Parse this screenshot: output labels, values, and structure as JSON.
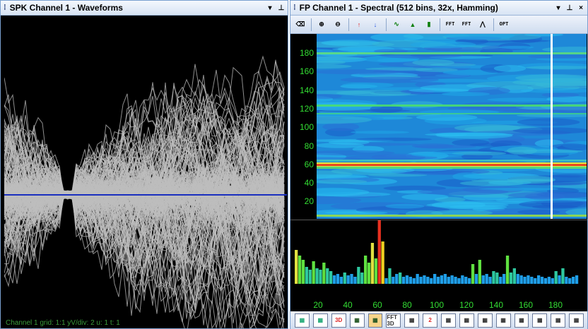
{
  "left_panel": {
    "title": "SPK Channel 1 - Waveforms",
    "pin_icon": "▾",
    "dock_icon": "⊥",
    "status_text": "Channel 1   grid: 1:1   yV/div: 2   u: 1   t: 1",
    "colors": {
      "waveform": "#bdbdbd",
      "baseline": "#1a2fbf",
      "background": "#000000"
    }
  },
  "right_panel": {
    "title": "FP Channel 1 - Spectral (512 bins, 32x, Hamming)",
    "pin_icon": "▾",
    "dock_icon": "⊥",
    "close_icon": "×",
    "toolbar": [
      {
        "name": "eraser-icon",
        "label": "⌫"
      },
      {
        "name": "zoom-in-icon",
        "label": "⊕"
      },
      {
        "name": "zoom-out-icon",
        "label": "⊖"
      },
      {
        "name": "scale-up-icon",
        "label": "↑"
      },
      {
        "name": "scale-down-icon",
        "label": "↓"
      },
      {
        "name": "line-plot-icon",
        "label": "∿"
      },
      {
        "name": "area-plot-icon",
        "label": "▲"
      },
      {
        "name": "bar-plot-icon",
        "label": "▮"
      },
      {
        "name": "fft-settings-icon",
        "label": "FFT"
      },
      {
        "name": "fft-bins-icon",
        "label": "FFT"
      },
      {
        "name": "peak-icon",
        "label": "⋀"
      },
      {
        "name": "options-icon",
        "label": "OPT"
      }
    ],
    "y_ticks": [
      "180",
      "160",
      "140",
      "120",
      "100",
      "80",
      "60",
      "40",
      "20"
    ],
    "x_ticks": [
      "20",
      "40",
      "60",
      "80",
      "100",
      "120",
      "140",
      "160",
      "180"
    ],
    "bottom_buttons": [
      {
        "name": "view-a-button",
        "label": ""
      },
      {
        "name": "view-b-button",
        "label": ""
      },
      {
        "name": "3d-button",
        "label": "3D"
      },
      {
        "name": "spectrum-view-button",
        "label": ""
      },
      {
        "name": "waterfall-view-button",
        "label": ""
      },
      {
        "name": "fft-3d-button",
        "label": "FFT 3D"
      },
      {
        "name": "grid-view-button",
        "label": ""
      },
      {
        "name": "channel-2-button",
        "label": "2"
      },
      {
        "name": "view-c-button",
        "label": ""
      },
      {
        "name": "view-d-button",
        "label": ""
      },
      {
        "name": "view-e-button",
        "label": ""
      },
      {
        "name": "view-f-button",
        "label": ""
      },
      {
        "name": "view-g-button",
        "label": ""
      },
      {
        "name": "view-h-button",
        "label": ""
      },
      {
        "name": "view-i-button",
        "label": ""
      },
      {
        "name": "view-j-button",
        "label": ""
      }
    ],
    "colors": {
      "axis_text": "#33dd33",
      "cursor": "#ffffff"
    }
  }
}
